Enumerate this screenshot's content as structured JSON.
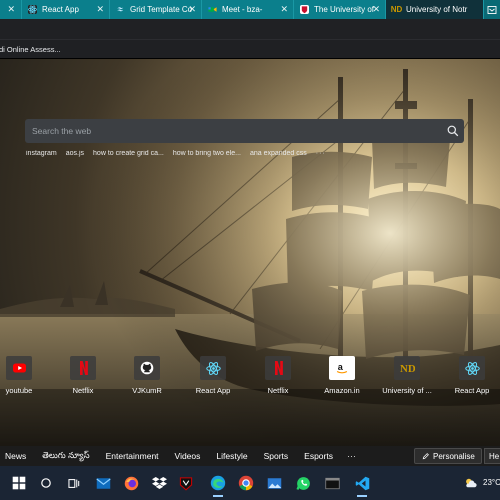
{
  "browser": {
    "tabs": [
      {
        "label": "React App",
        "icon": "react-icon",
        "active": false
      },
      {
        "label": "Grid Template Co",
        "icon": "tailwind-icon",
        "active": false
      },
      {
        "label": "Meet - bza-",
        "icon": "meet-icon",
        "active": false
      },
      {
        "label": "The University of",
        "icon": "university-icon",
        "active": false
      },
      {
        "label": "University of Notr",
        "icon": "notre-dame-icon",
        "active": false
      }
    ],
    "close_glyph": "✕",
    "bookmark": "di Online Assess..."
  },
  "search": {
    "placeholder": "Search the web",
    "quick_links": [
      "instagram",
      "aos.js",
      "how to create grid ca...",
      "how to bring two ele...",
      "ana expanded css"
    ],
    "more": "···"
  },
  "top_sites": [
    {
      "label": "youtube",
      "icon": "youtube-icon"
    },
    {
      "label": "Netflix",
      "icon": "netflix-icon"
    },
    {
      "label": "VJKumR",
      "icon": "github-icon"
    },
    {
      "label": "React App",
      "icon": "react-icon"
    },
    {
      "label": "Netflix",
      "icon": "netflix-icon"
    },
    {
      "label": "Amazon.in",
      "icon": "amazon-icon"
    },
    {
      "label": "University of ...",
      "icon": "notre-dame-icon"
    },
    {
      "label": "React App",
      "icon": "react-icon"
    }
  ],
  "news": {
    "items": [
      "News",
      "తెలుగు న్యూస్",
      "Entertainment",
      "Videos",
      "Lifestyle",
      "Sports",
      "Esports"
    ],
    "more": "···",
    "personalise": "Personalise",
    "next_button": "He"
  },
  "taskbar": {
    "temperature": "23°C"
  },
  "colors": {
    "tabstrip": "#0b7f8c",
    "netflix": "#e50914",
    "youtube": "#ff0000",
    "react": "#61dafb"
  }
}
